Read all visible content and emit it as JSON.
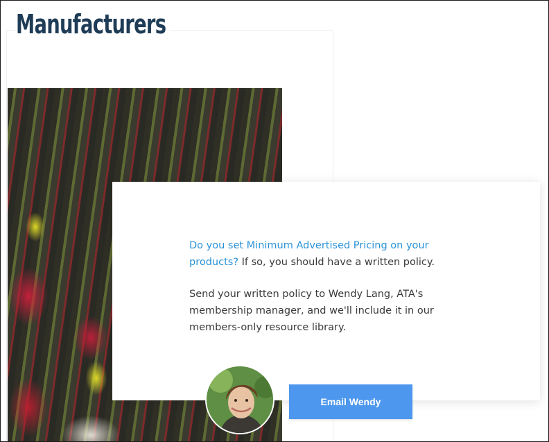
{
  "page": {
    "title": "Manufacturers"
  },
  "popup": {
    "question_link": "Do you set Minimum Advertised Pricing on your products?",
    "question_rest": " If so, you should have a written policy.",
    "body": "Send your written policy to Wendy Lang, ATA's membership manager, and we'll include it in our members-only resource library.",
    "button_label": "Email Wendy"
  },
  "colors": {
    "heading": "#1f3c57",
    "link": "#2a93d8",
    "button": "#4d97ee"
  },
  "images": {
    "hero": "arrows-photo",
    "avatar": "wendy-portrait"
  }
}
